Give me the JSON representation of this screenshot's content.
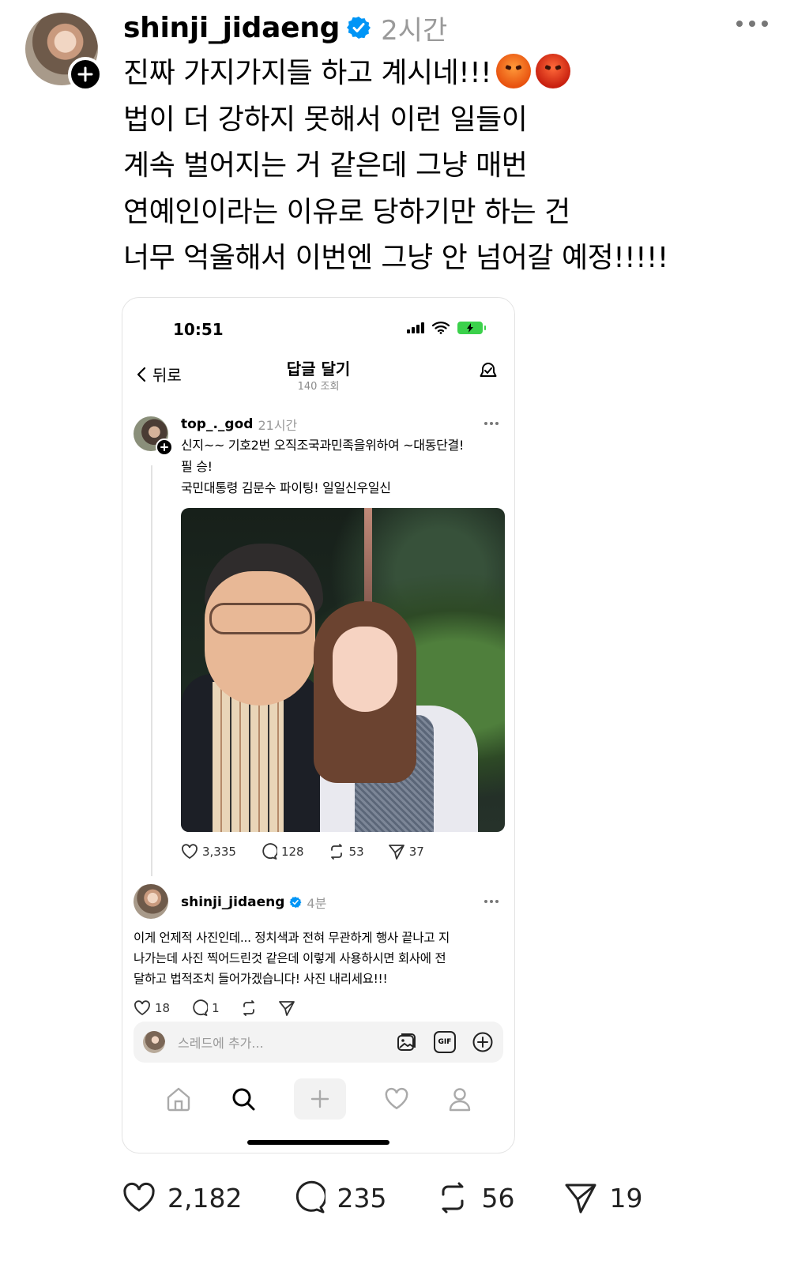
{
  "post": {
    "username": "shinji_jidaeng",
    "time": "2시간",
    "lines": [
      "진짜 가지가지들 하고 계시네!!!",
      "법이 더 강하지 못해서 이런 일들이",
      "계속 벌어지는 거 같은데 그냥 매번",
      "연예인이라는 이유로 당하기만 하는 건",
      "너무 억울해서 이번엔 그냥 안 넘어갈 예정!!!!!"
    ],
    "emoji_cursing_text": "&$!#%",
    "stats": {
      "likes": "2,182",
      "comments": "235",
      "reposts": "56",
      "shares": "19"
    }
  },
  "screenshot": {
    "status_time": "10:51",
    "back_label": "뒤로",
    "title": "답글 달기",
    "views": "140 조회",
    "original": {
      "username": "top_._god",
      "time": "21시간",
      "lines": [
        "신지~~ 기호2번  오직조국과민족을위하여 ~대동단결!",
        "필 승!",
        "국민대통령 김문수 파이팅! 일일신우일신"
      ],
      "stats": {
        "likes": "3,335",
        "comments": "128",
        "reposts": "53",
        "shares": "37"
      }
    },
    "reply": {
      "username": "shinji_jidaeng",
      "time": "4분",
      "lines": [
        "이게 언제적 사진인데... 정치색과 전혀 무관하게 행사 끝나고 지",
        "나가는데 사진 찍어드린것 같은데 이렇게 사용하시면 회사에 전",
        "달하고 법적조치 들어가겠습니다! 사진 내리세요!!!"
      ],
      "stats": {
        "likes": "18",
        "comments": "1"
      }
    },
    "composer_placeholder": "스레드에 추가...",
    "gif_label": "GIF"
  },
  "colors": {
    "verified": "#0095f6",
    "muted": "#9a9a9a",
    "battery": "#3bd14b"
  }
}
